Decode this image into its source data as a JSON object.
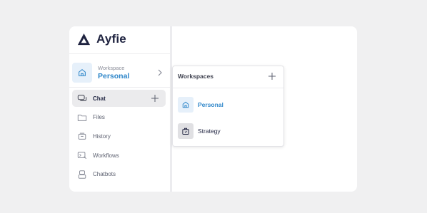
{
  "brand": {
    "name": "Ayfie",
    "color": "#1f2340"
  },
  "workspace": {
    "caption": "Workspace",
    "name": "Personal",
    "accent": "#2e86c9"
  },
  "nav": {
    "items": [
      {
        "label": "Chat",
        "icon": "chat-icon",
        "active": true
      },
      {
        "label": "Files",
        "icon": "folder-icon"
      },
      {
        "label": "History",
        "icon": "history-icon"
      },
      {
        "label": "Workflows",
        "icon": "workflows-icon"
      },
      {
        "label": "Chatbots",
        "icon": "chatbots-icon"
      }
    ]
  },
  "workspaces_popup": {
    "title": "Workspaces",
    "items": [
      {
        "label": "Personal",
        "icon": "home-icon",
        "selected": true
      },
      {
        "label": "Strategy",
        "icon": "briefcase-icon"
      }
    ]
  }
}
